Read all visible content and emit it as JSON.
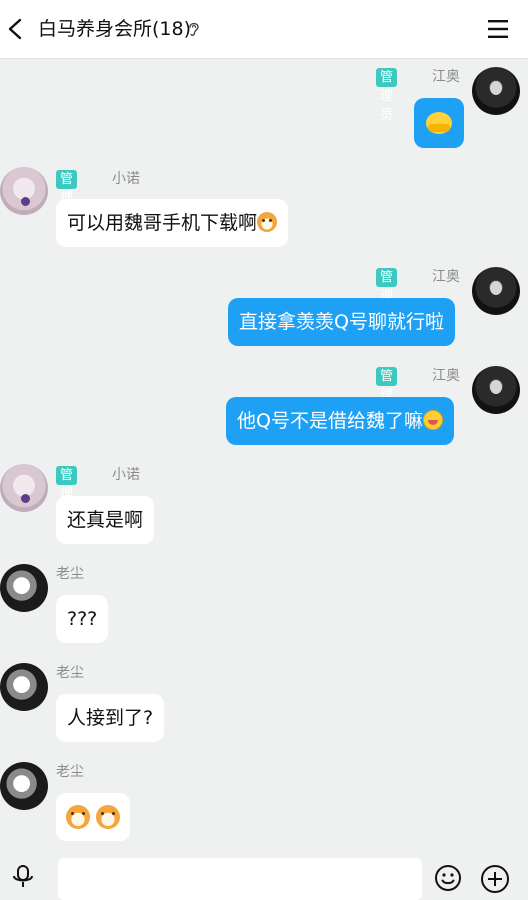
{
  "header": {
    "title": "白马养身会所(18)"
  },
  "messages": [
    {
      "role": "管理员",
      "sender": "江奥",
      "text": "",
      "emoji": "hugging-face"
    },
    {
      "role": "管理员",
      "sender": "小诺",
      "text": "可以用魏哥手机下载啊",
      "emoji": "dog-face"
    },
    {
      "role": "管理员",
      "sender": "江奥",
      "text": "直接拿羡羡Q号聊就行啦"
    },
    {
      "role": "管理员",
      "sender": "江奥",
      "text": "他Q号不是借给魏了嘛",
      "emoji": "laughing-face"
    },
    {
      "role": "管理员",
      "sender": "小诺",
      "text": "还真是啊"
    },
    {
      "sender": "老尘",
      "text": "???"
    },
    {
      "sender": "老尘",
      "text": "人接到了?"
    },
    {
      "sender": "老尘",
      "text": "",
      "emoji": "dog-face dog-face"
    }
  ],
  "input": {
    "placeholder": ""
  },
  "colors": {
    "badge": "#3cc9c0",
    "outgoing_bubble": "#1ea0f5",
    "incoming_bubble": "#ffffff",
    "background": "#eef1ef"
  },
  "icons": [
    "back-arrow-icon",
    "ear-icon",
    "menu-icon",
    "microphone-icon",
    "smiley-icon",
    "plus-icon"
  ]
}
